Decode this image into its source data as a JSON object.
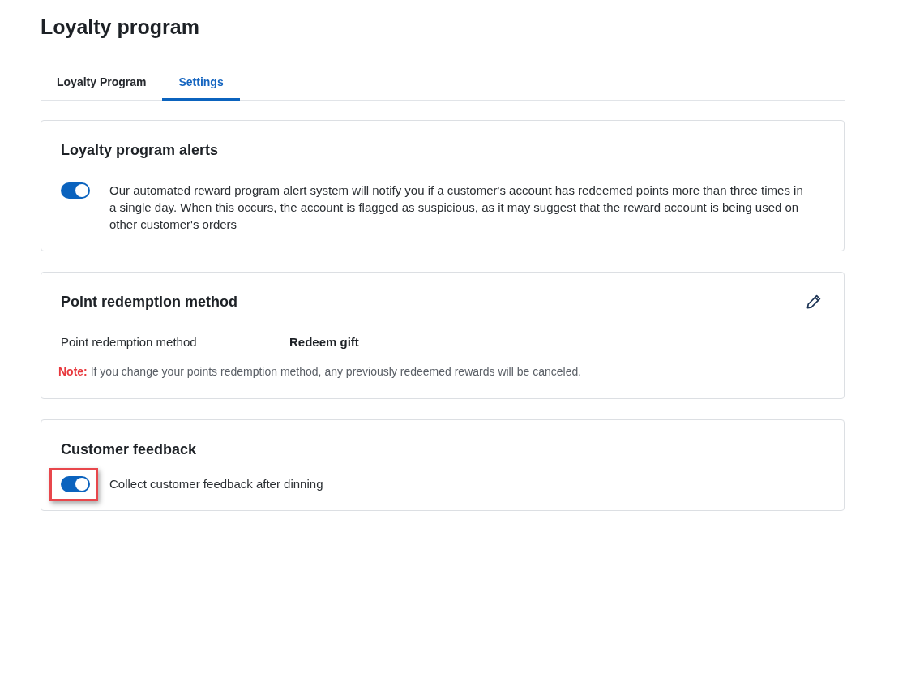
{
  "page": {
    "title": "Loyalty program"
  },
  "tabs": [
    {
      "label": "Loyalty Program",
      "selected": false
    },
    {
      "label": "Settings",
      "selected": true
    }
  ],
  "sections": [
    {
      "kind": "toggle",
      "title": "Loyalty program alerts",
      "toggle": {
        "on": true,
        "highlighted": false
      },
      "text": "Our automated reward program alert system will notify you if a customer's account has redeemed points more than three times in a single day. When this occurs, the account is flagged as suspicious, as it may suggest that the reward account is being used on other customer's orders"
    },
    {
      "kind": "detail",
      "title": "Point redemption method",
      "field": {
        "label": "Point redemption method",
        "value": "Redeem gift"
      },
      "note": "**Note:** If you change your points redemption method, any previously redeemed rewards will be canceled."
    },
    {
      "kind": "toggle",
      "title": "Customer feedback",
      "toggle": {
        "on": true,
        "highlighted": true
      },
      "text": "Collect customer feedback after dinning"
    }
  ]
}
